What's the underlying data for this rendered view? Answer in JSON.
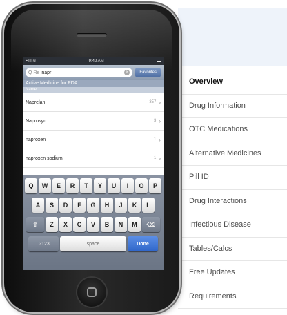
{
  "features": [
    {
      "label": "Overview",
      "active": true
    },
    {
      "label": "Drug Information"
    },
    {
      "label": "OTC Medications"
    },
    {
      "label": "Alternative Medicines"
    },
    {
      "label": "Pill ID"
    },
    {
      "label": "Drug Interactions"
    },
    {
      "label": "Infectious Disease"
    },
    {
      "label": "Tables/Calcs"
    },
    {
      "label": "Free Updates"
    },
    {
      "label": "Requirements"
    }
  ],
  "phone": {
    "status": {
      "left": "••lıl ≋",
      "time": "9:42 AM",
      "right": "▬"
    },
    "search": {
      "scope": "Q Re",
      "value": "napr|",
      "favorites": "Favorites"
    },
    "section_title": "Active Medicine for PDA",
    "column_header": "Name",
    "results": [
      {
        "name": "Naprelan",
        "count": "357"
      },
      {
        "name": "Naprosyn",
        "count": "3"
      },
      {
        "name": "naproxen",
        "count": "1"
      },
      {
        "name": "naproxen sodium",
        "count": "1"
      }
    ],
    "keyboard": {
      "row1": [
        "Q",
        "W",
        "E",
        "R",
        "T",
        "Y",
        "U",
        "I",
        "O",
        "P"
      ],
      "row2": [
        "A",
        "S",
        "D",
        "F",
        "G",
        "H",
        "J",
        "K",
        "L"
      ],
      "row3": [
        "Z",
        "X",
        "C",
        "V",
        "B",
        "N",
        "M"
      ],
      "shift": "⇧",
      "backspace": "⌫",
      "numbers": ".?123",
      "space": "space",
      "done": "Done"
    }
  }
}
